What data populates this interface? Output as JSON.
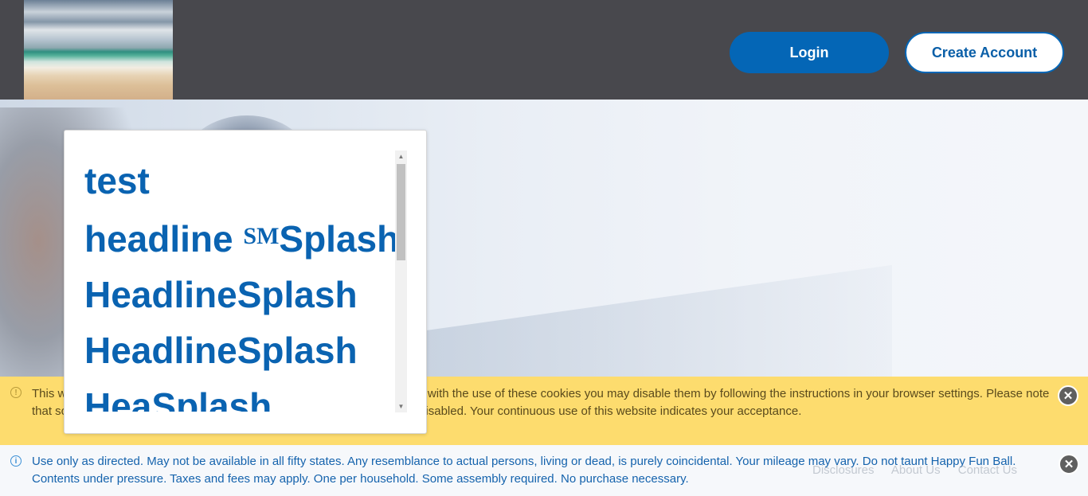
{
  "header": {
    "login_label": "Login",
    "create_account_label": "Create Account"
  },
  "splash": {
    "lines": [
      "test",
      "headline",
      "HeadlineSplash",
      "HeadlineSplash",
      "HeaSplash"
    ],
    "sm_mark": "SM",
    "line2_suffix": "Splash"
  },
  "cookie_banner": {
    "text": "This website uses cookies to improve your experience. If you do not agree with the use of these cookies you may disable them by following the instructions in your browser settings. Please note that some features of the services may not function as well if cookies are disabled. Your continuous use of this website indicates your acceptance."
  },
  "notice_banner": {
    "text": "Use only as directed. May not be available in all fifty states. Any resemblance to actual persons, living or dead, is purely coincidental. Your mileage may vary. Do not taunt Happy Fun Ball. Contents under pressure. Taxes and fees may apply. One per household. Some assembly required. No purchase necessary."
  },
  "footer": {
    "links": [
      "Disclosures",
      "About Us",
      "Contact Us"
    ]
  },
  "icons": {
    "warning": "info-circle-icon",
    "info": "info-circle-icon",
    "close": "close-icon"
  },
  "colors": {
    "header_bg": "#48484d",
    "primary": "#0466b6",
    "cookie_bg": "#fddc6e",
    "splash_text": "#0a63b1"
  }
}
